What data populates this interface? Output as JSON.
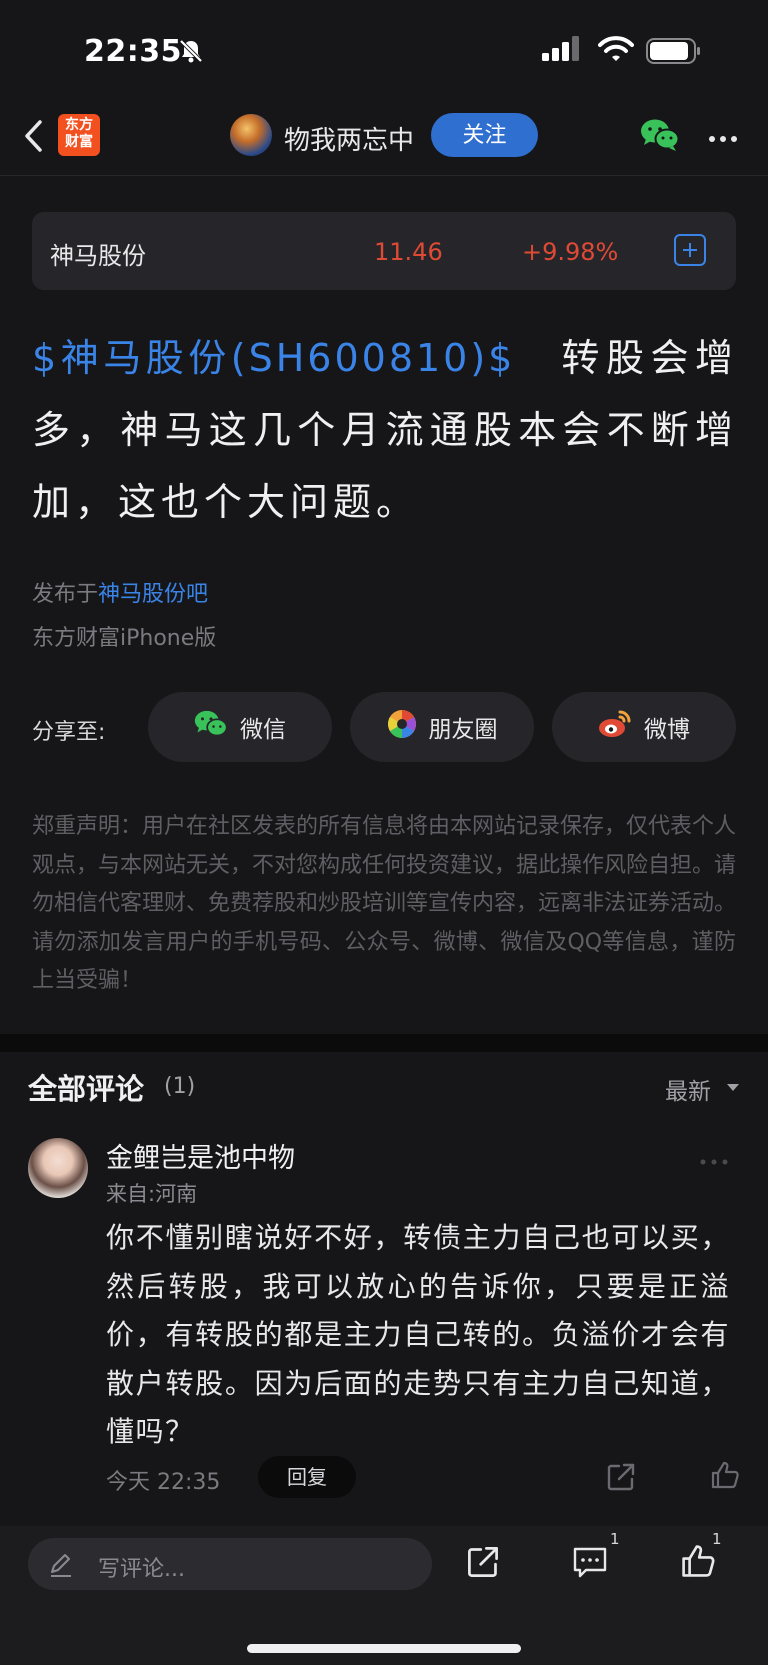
{
  "status_bar": {
    "time": "22:35"
  },
  "nav": {
    "logo_line1": "东方",
    "logo_line2": "财富",
    "username": "物我两忘中",
    "follow_label": "关注"
  },
  "stock": {
    "name": "神马股份",
    "price": "11.46",
    "change": "+9.98%"
  },
  "post": {
    "tag": "$神马股份(SH600810)$",
    "body": "转股会增多，神马这几个月流通股本会不断增加，这也个大问题。"
  },
  "meta": {
    "published_prefix": "发布于",
    "forum_link": "神马股份吧",
    "client": "东方财富iPhone版"
  },
  "share": {
    "label": "分享至:",
    "buttons": [
      "微信",
      "朋友圈",
      "微博"
    ]
  },
  "disclaimer": "郑重声明：用户在社区发表的所有信息将由本网站记录保存，仅代表个人观点，与本网站无关，不对您构成任何投资建议，据此操作风险自担。请勿相信代客理财、免费荐股和炒股培训等宣传内容，远离非法证券活动。请勿添加发言用户的手机号码、公众号、微博、微信及QQ等信息，谨防上当受骗！",
  "comments": {
    "header": "全部评论",
    "count": "(1)",
    "sort": "最新",
    "items": [
      {
        "author": "金鲤岂是池中物",
        "location": "来自:河南",
        "text": "你不懂别瞎说好不好，转债主力自己也可以买，然后转股，我可以放心的告诉你，只要是正溢价，有转股的都是主力自己转的。负溢价才会有散户转股。因为后面的走势只有主力自己知道，懂吗？",
        "time": "今天 22:35",
        "reply_label": "回复"
      }
    ]
  },
  "bottom": {
    "input_placeholder": "写评论...",
    "comment_count": "1",
    "like_count": "1"
  },
  "colors": {
    "accent": "#3a84e8",
    "up": "#e04a35",
    "follow": "#2f6fd0",
    "wechat": "#39c15a",
    "logo": "#f2501f"
  },
  "icons": [
    "bell-slash-icon",
    "signal-icon",
    "wifi-icon",
    "battery-icon",
    "back-icon",
    "wechat-icon",
    "more-icon",
    "add-stock-icon",
    "moments-icon",
    "weibo-icon",
    "share-icon",
    "like-icon",
    "edit-icon",
    "comment-icon"
  ]
}
